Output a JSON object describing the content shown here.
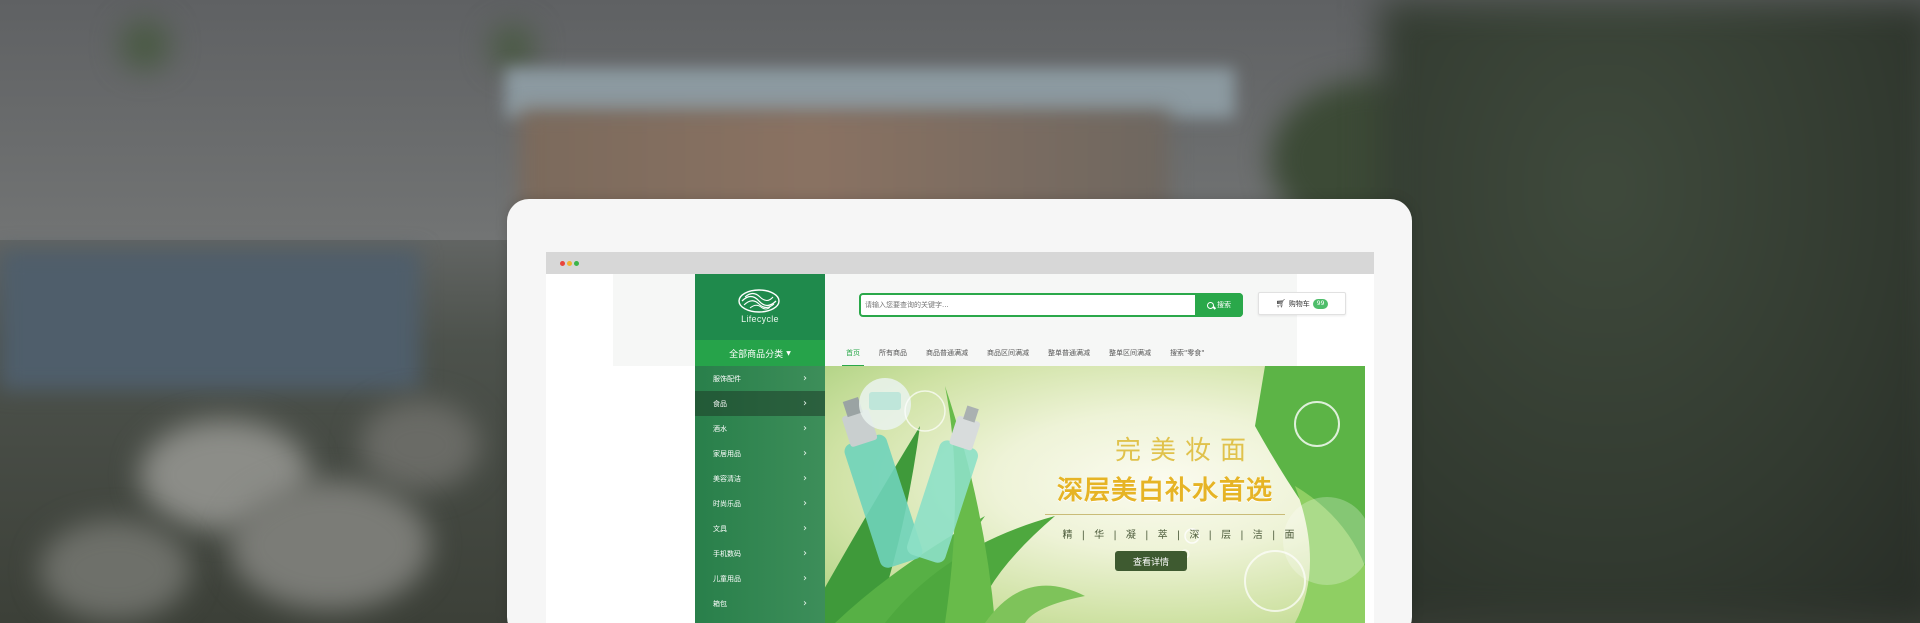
{
  "browser": {
    "dots": [
      "red",
      "yellow",
      "green"
    ]
  },
  "site": {
    "logo_text": "Lifecycle",
    "search": {
      "placeholder": "请输入您要查询的关键字...",
      "button_label": "搜索",
      "icon": "search-icon"
    },
    "cart": {
      "label": "购物车",
      "count": "99",
      "icon": "cart-icon"
    },
    "category_header": "全部商品分类",
    "nav": [
      "首页",
      "所有商品",
      "商品普通满减",
      "商品区间满减",
      "整单普通满减",
      "整单区间满减",
      "搜索\"零食\""
    ],
    "categories": [
      "服饰配件",
      "食品",
      "酒水",
      "家居用品",
      "美容清洁",
      "时尚乐品",
      "文具",
      "手机数码",
      "儿童用品",
      "箱包"
    ],
    "banner": {
      "title_line1": "完美妆面",
      "title_line2": "深层美白补水首选",
      "tags": "精 | 华 | 凝 | 萃 | 深 | 层 | 洁 | 面",
      "button_label": "查看详情"
    }
  },
  "colors": {
    "brand_green": "#1f8a4c",
    "accent_green": "#2aa84a",
    "banner_gold": "#e6b425"
  }
}
